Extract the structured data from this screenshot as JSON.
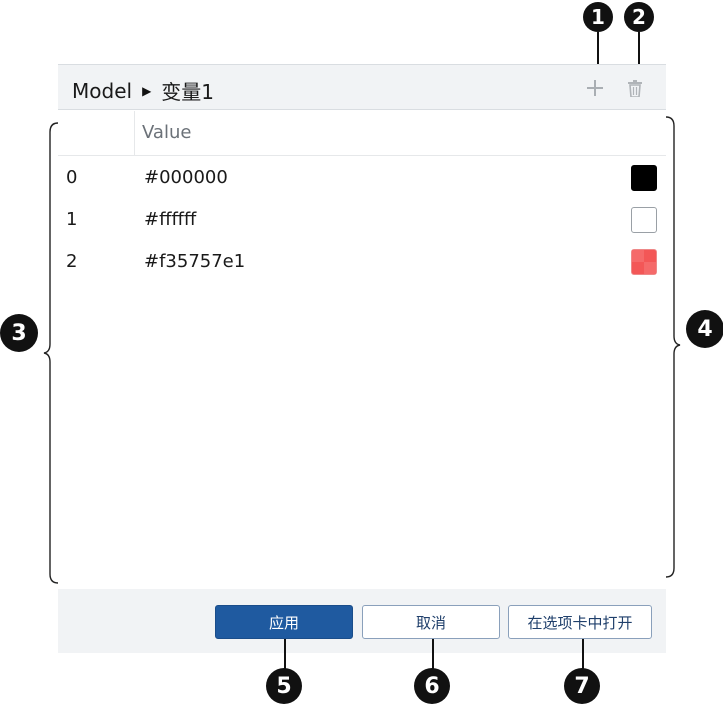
{
  "callouts": [
    "1",
    "2",
    "3",
    "4",
    "5",
    "6",
    "7"
  ],
  "header": {
    "breadcrumb_root": "Model",
    "breadcrumb_separator": "▶",
    "breadcrumb_current": "变量1",
    "add_icon": "plus-icon",
    "delete_icon": "trash-icon"
  },
  "table": {
    "value_header": "Value",
    "rows": [
      {
        "index": "0",
        "value": "#000000",
        "color": "#000000"
      },
      {
        "index": "1",
        "value": "#ffffff",
        "color": "#ffffff"
      },
      {
        "index": "2",
        "value": "#f35757e1",
        "color": "#f35757"
      }
    ]
  },
  "footer": {
    "apply_label": "应用",
    "cancel_label": "取消",
    "open_tab_label": "在选项卡中打开"
  },
  "colors": {
    "primary": "#1f5aa0",
    "header_bg": "#f1f3f5",
    "callout": "#111111"
  }
}
